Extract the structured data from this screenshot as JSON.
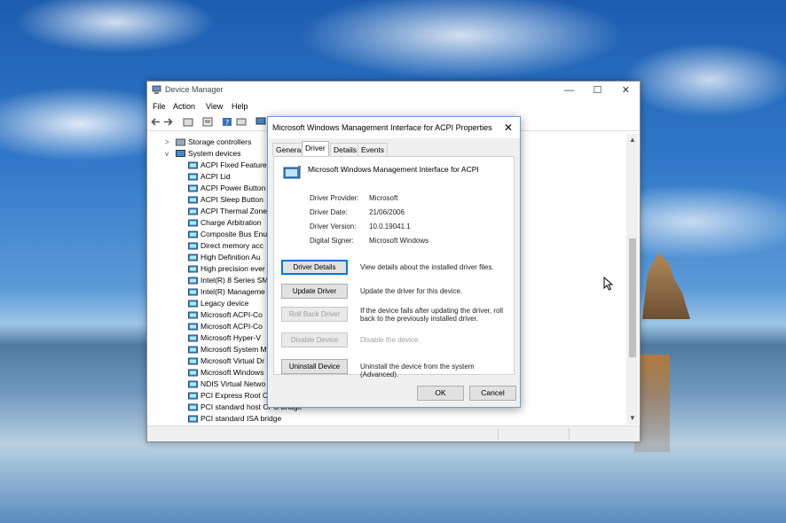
{
  "device_manager": {
    "title": "Device Manager",
    "menu": [
      "File",
      "Action",
      "View",
      "Help"
    ],
    "tree": [
      {
        "label": "Storage controllers",
        "chevron": ">",
        "level": 0
      },
      {
        "label": "System devices",
        "chevron": "v",
        "level": 0
      },
      {
        "label": "ACPI Fixed Feature",
        "level": 1
      },
      {
        "label": "ACPI Lid",
        "level": 1
      },
      {
        "label": "ACPI Power Button",
        "level": 1
      },
      {
        "label": "ACPI Sleep Button",
        "level": 1
      },
      {
        "label": "ACPI Thermal Zone",
        "level": 1
      },
      {
        "label": "Charge Arbitration",
        "level": 1
      },
      {
        "label": "Composite Bus Enu",
        "level": 1
      },
      {
        "label": "Direct memory acc",
        "level": 1
      },
      {
        "label": "High Definition Au",
        "level": 1
      },
      {
        "label": "High precision ever",
        "level": 1
      },
      {
        "label": "Intel(R) 8 Series SM",
        "level": 1
      },
      {
        "label": "Intel(R) Manageme",
        "level": 1
      },
      {
        "label": "Legacy device",
        "level": 1
      },
      {
        "label": "Microsoft ACPI-Co",
        "level": 1
      },
      {
        "label": "Microsoft ACPI-Co",
        "level": 1
      },
      {
        "label": "Microsoft Hyper-V",
        "level": 1
      },
      {
        "label": "Microsoft System M",
        "level": 1
      },
      {
        "label": "Microsoft Virtual Dr",
        "level": 1
      },
      {
        "label": "Microsoft Windows",
        "level": 1
      },
      {
        "label": "NDIS Virtual Netwo",
        "level": 1
      },
      {
        "label": "PCI Express Root Co",
        "level": 1
      },
      {
        "label": "PCI standard host CPU bridge",
        "level": 1
      },
      {
        "label": "PCI standard ISA bridge",
        "level": 1
      }
    ],
    "window_controls": {
      "minimize": "—",
      "maximize": "☐",
      "close": "✕"
    }
  },
  "dialog": {
    "title": "Microsoft Windows Management Interface for ACPI Properties",
    "close": "✕",
    "tabs": [
      {
        "label": "General",
        "active": false
      },
      {
        "label": "Driver",
        "active": true
      },
      {
        "label": "Details",
        "active": false
      },
      {
        "label": "Events",
        "active": false
      }
    ],
    "device_name": "Microsoft Windows Management Interface for ACPI",
    "properties": [
      {
        "label": "Driver Provider:",
        "value": "Microsoft"
      },
      {
        "label": "Driver Date:",
        "value": "21/06/2006"
      },
      {
        "label": "Driver Version:",
        "value": "10.0.19041.1"
      },
      {
        "label": "Digital Signer:",
        "value": "Microsoft Windows"
      }
    ],
    "actions": [
      {
        "button": "Driver Details",
        "description": "View details about the installed driver files.",
        "enabled": true,
        "focused": true
      },
      {
        "button": "Update Driver",
        "description": "Update the driver for this device.",
        "enabled": true,
        "focused": false
      },
      {
        "button": "Roll Back Driver",
        "description": "If the device fails after updating the driver, roll back to the previously installed driver.",
        "enabled": false,
        "focused": false
      },
      {
        "button": "Disable Device",
        "description": "Disable the device.",
        "enabled": false,
        "focused": false
      },
      {
        "button": "Uninstall Device",
        "description": "Uninstall the device from the system (Advanced).",
        "enabled": true,
        "focused": false
      }
    ],
    "ok": "OK",
    "cancel": "Cancel"
  },
  "colors": {
    "accent": "#0078d7",
    "disabled_text": "#a0a0a0",
    "dialog_bg": "#f0f0f0"
  }
}
